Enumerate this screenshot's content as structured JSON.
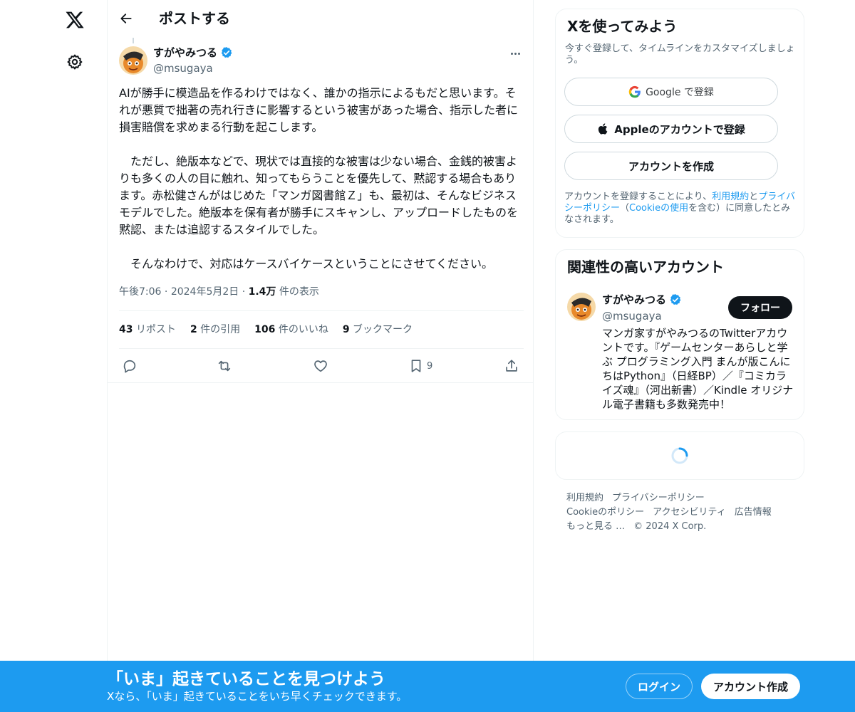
{
  "header": {
    "title": "ポストする"
  },
  "post": {
    "author_name": "すがやみつる",
    "author_handle": "@msugaya",
    "paragraphs": [
      "AIが勝手に模造品を作るわけではなく、誰かの指示によるもだと思います。それが悪質で拙著の売れ行きに影響するという被害があった場合、指示した者に損害賠償を求めまる行動を起こします。",
      "",
      "　ただし、絶版本などで、現状では直接的な被害は少ない場合、金銭的被害よりも多くの人の目に触れ、知ってもらうことを優先して、黙認する場合もあります。赤松健さんがはじめた「マンガ図書館Ｚ」も、最初は、そんなビジネスモデルでした。絶版本を保有者が勝手にスキャンし、アップロードしたものを黙認、または追認するスタイルでした。",
      "",
      "　そんなわけで、対応はケースバイケースということにさせてください。"
    ],
    "time": "午後7:06",
    "date": "2024年5月2日",
    "sep": "·",
    "views_count": "1.4万",
    "views_label": "件の表示",
    "stats": {
      "reposts_num": "43",
      "reposts_label": "リポスト",
      "quotes_num": "2",
      "quotes_label": "件の引用",
      "likes_num": "106",
      "likes_label": "件のいいね",
      "bookmarks_num": "9",
      "bookmarks_label": "ブックマーク"
    },
    "bookmark_count": "9"
  },
  "signup": {
    "title": "Xを使ってみよう",
    "subtitle": "今すぐ登録して、タイムラインをカスタマイズしましょう。",
    "google_label": "Google で登録",
    "apple_label": "Appleのアカウントで登録",
    "create_label": "アカウントを作成",
    "legal_prefix": "アカウントを登録することにより、",
    "legal_terms": "利用規約",
    "legal_and": "と",
    "legal_privacy": "プライバシーポリシー",
    "legal_paren_open": "（",
    "legal_cookie": "Cookieの使用",
    "legal_suffix": "を含む）に同意したとみなされます。"
  },
  "related": {
    "title": "関連性の高いアカウント",
    "name": "すがやみつる",
    "handle": "@msugaya",
    "follow_label": "フォロー",
    "bio": "マンガ家すがやみつるのTwitterアカウントです。『ゲームセンターあらしと学ぶ プログラミング入門 まんが版こんにちはPython』（日経BP）／『コミカライズ魂』（河出新書）／Kindle オリジナル電子書籍も多数発売中！"
  },
  "footer": {
    "terms": "利用規約",
    "privacy": "プライバシーポリシー",
    "cookie": "Cookieのポリシー",
    "accessibility": "アクセシビリティ",
    "ads": "広告情報",
    "more": "もっと見る …",
    "copyright": "© 2024 X Corp."
  },
  "banner": {
    "title": "「いま」起きていることを見つけよう",
    "subtitle": "Xなら、「いま」起きていることをいち早くチェックできます。",
    "login_label": "ログイン",
    "signup_label": "アカウント作成"
  },
  "icons": {
    "logo": "x-logo-icon",
    "settings": "gear-icon",
    "back": "back-arrow-icon",
    "verified": "verified-badge-icon",
    "more": "more-icon",
    "reply": "reply-icon",
    "repost": "repost-icon",
    "like": "heart-icon",
    "bookmark": "bookmark-icon",
    "share": "share-icon",
    "google": "google-icon",
    "apple": "apple-icon",
    "spinner": "loading-spinner-icon"
  },
  "colors": {
    "accent": "#1d9bf0",
    "text": "#0f1419",
    "muted": "#536471",
    "border": "#eff3f4"
  }
}
